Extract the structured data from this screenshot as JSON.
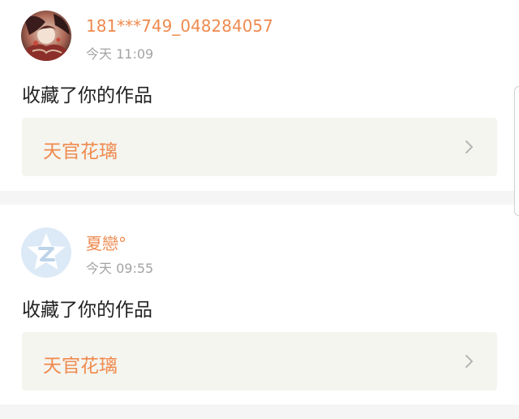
{
  "notifications": [
    {
      "username": "181***749_048284057",
      "timestamp": "今天 11:09",
      "action": "收藏了你的作品",
      "work_title": "天官花璃",
      "avatar_icon": "anime-portrait-avatar"
    },
    {
      "username": "夏戀°",
      "timestamp": "今天 09:55",
      "action": "收藏了你的作品",
      "work_title": "天官花璃",
      "avatar_icon": "default-star-z-avatar"
    }
  ],
  "colors": {
    "accent": "#ef8a4e",
    "timestamp": "#a3a3a3",
    "link_bg": "#f5f5f0",
    "separator": "#f5f5f5",
    "default_avatar": "#dce9f6"
  }
}
